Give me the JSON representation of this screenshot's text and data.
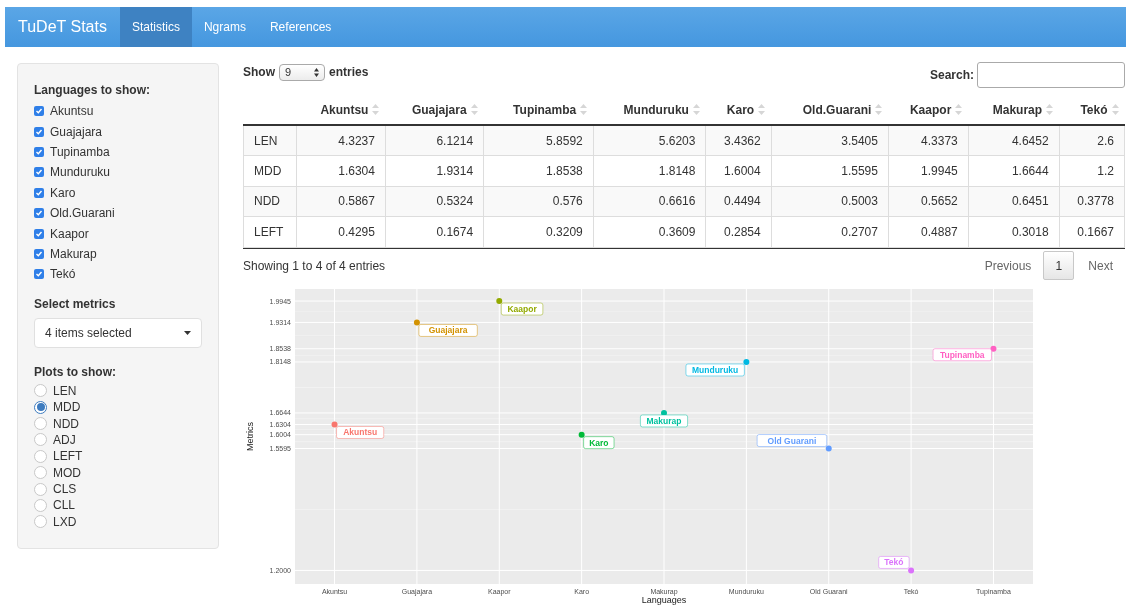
{
  "navbar": {
    "brand": "TuDeT Stats",
    "tabs": [
      {
        "label": "Statistics",
        "selected": true
      },
      {
        "label": "Ngrams",
        "selected": false
      },
      {
        "label": "References",
        "selected": false
      }
    ]
  },
  "sidebar": {
    "languages_title": "Languages to show:",
    "languages": [
      {
        "label": "Akuntsu",
        "checked": true
      },
      {
        "label": "Guajajara",
        "checked": true
      },
      {
        "label": "Tupinamba",
        "checked": true
      },
      {
        "label": "Munduruku",
        "checked": true
      },
      {
        "label": "Karo",
        "checked": true
      },
      {
        "label": "Old.Guarani",
        "checked": true
      },
      {
        "label": "Kaapor",
        "checked": true
      },
      {
        "label": "Makurap",
        "checked": true
      },
      {
        "label": "Tekó",
        "checked": true
      }
    ],
    "metrics_title": "Select metrics",
    "metrics_value": "4 items selected",
    "plots_title": "Plots to show:",
    "plots": [
      {
        "label": "LEN",
        "selected": false
      },
      {
        "label": "MDD",
        "selected": true
      },
      {
        "label": "NDD",
        "selected": false
      },
      {
        "label": "ADJ",
        "selected": false
      },
      {
        "label": "LEFT",
        "selected": false
      },
      {
        "label": "MOD",
        "selected": false
      },
      {
        "label": "CLS",
        "selected": false
      },
      {
        "label": "CLL",
        "selected": false
      },
      {
        "label": "LXD",
        "selected": false
      }
    ]
  },
  "table_controls": {
    "show_label": "Show",
    "page_size": "9",
    "entries_label": "entries",
    "search_label": "Search:"
  },
  "table": {
    "columns": [
      "Akuntsu",
      "Guajajara",
      "Tupinamba",
      "Munduruku",
      "Karo",
      "Old.Guarani",
      "Kaapor",
      "Makurap",
      "Tekó"
    ],
    "rows": [
      {
        "metric": "LEN",
        "cells": [
          "4.3237",
          "6.1214",
          "5.8592",
          "5.6203",
          "3.4362",
          "3.5405",
          "4.3373",
          "4.6452",
          "2.6"
        ]
      },
      {
        "metric": "MDD",
        "cells": [
          "1.6304",
          "1.9314",
          "1.8538",
          "1.8148",
          "1.6004",
          "1.5595",
          "1.9945",
          "1.6644",
          "1.2"
        ]
      },
      {
        "metric": "NDD",
        "cells": [
          "0.5867",
          "0.5324",
          "0.576",
          "0.6616",
          "0.4494",
          "0.5003",
          "0.5652",
          "0.6451",
          "0.3778"
        ]
      },
      {
        "metric": "LEFT",
        "cells": [
          "0.4295",
          "0.1674",
          "0.3209",
          "0.3609",
          "0.2854",
          "0.2707",
          "0.4887",
          "0.3018",
          "0.1667"
        ]
      }
    ]
  },
  "pagination": {
    "info": "Showing 1 to 4 of 4 entries",
    "previous": "Previous",
    "pages": [
      {
        "label": "1",
        "selected": true
      }
    ],
    "next": "Next"
  },
  "chart_data": {
    "type": "scatter",
    "xlabel": "Languages",
    "ylabel": "Metrics",
    "categories": [
      "Akuntsu",
      "Guajajara",
      "Kaapor",
      "Karo",
      "Makurap",
      "Munduruku",
      "Old Guarani",
      "Tekó",
      "Tupinamba"
    ],
    "ylim": [
      1.16,
      2.03
    ],
    "yticks": [
      {
        "value": 1.2,
        "label": "1.2000"
      },
      {
        "value": 1.5595,
        "label": "1.5595"
      },
      {
        "value": 1.6004,
        "label": "1.6004"
      },
      {
        "value": 1.6304,
        "label": "1.6304"
      },
      {
        "value": 1.6644,
        "label": "1.6644"
      },
      {
        "value": 1.8148,
        "label": "1.8148"
      },
      {
        "value": 1.8538,
        "label": "1.8538"
      },
      {
        "value": 1.9314,
        "label": "1.9314"
      },
      {
        "value": 1.9945,
        "label": "1.9945"
      }
    ],
    "grid": true,
    "series": [
      {
        "name": "Akuntsu",
        "color": "#f8766d",
        "values": [
          1.6304,
          null,
          null,
          null,
          null,
          null,
          null,
          null,
          null
        ]
      },
      {
        "name": "Guajajara",
        "color": "#d39200",
        "values": [
          null,
          1.9314,
          null,
          null,
          null,
          null,
          null,
          null,
          null
        ]
      },
      {
        "name": "Kaapor",
        "color": "#93aa00",
        "values": [
          null,
          null,
          1.9945,
          null,
          null,
          null,
          null,
          null,
          null
        ]
      },
      {
        "name": "Karo",
        "color": "#00ba38",
        "values": [
          null,
          null,
          null,
          1.6004,
          null,
          null,
          null,
          null,
          null
        ]
      },
      {
        "name": "Makurap",
        "color": "#00c19f",
        "values": [
          null,
          null,
          null,
          null,
          1.6644,
          null,
          null,
          null,
          null
        ]
      },
      {
        "name": "Munduruku",
        "color": "#00b9e3",
        "values": [
          null,
          null,
          null,
          null,
          null,
          1.8148,
          null,
          null,
          null
        ]
      },
      {
        "name": "Old Guarani",
        "color": "#619cff",
        "values": [
          null,
          null,
          null,
          null,
          null,
          null,
          1.5595,
          null,
          null
        ]
      },
      {
        "name": "Tekó",
        "color": "#db72fb",
        "values": [
          null,
          null,
          null,
          null,
          null,
          null,
          null,
          1.2,
          null
        ]
      },
      {
        "name": "Tupinamba",
        "color": "#ff61c3",
        "values": [
          null,
          null,
          null,
          null,
          null,
          null,
          null,
          null,
          1.8538
        ]
      }
    ]
  }
}
